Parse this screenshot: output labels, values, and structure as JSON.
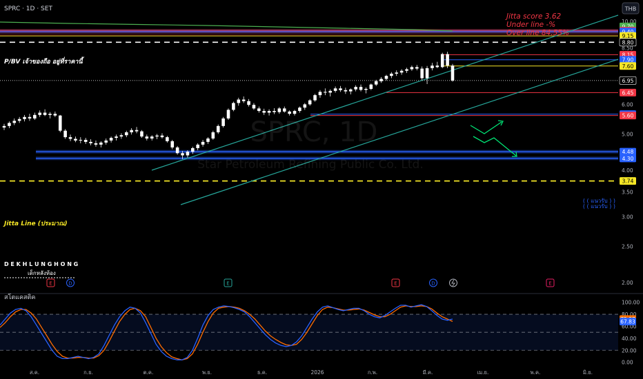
{
  "header": {
    "symbol_line": "SPRC · 1D · SET",
    "currency": "THB"
  },
  "watermark": {
    "ticker": "SPRC, 1D",
    "company": "Star Petroleum Refining Public Co. Ltd."
  },
  "jitta": {
    "score_text": "Jitta score  3.62",
    "under_text": "Under line  -%",
    "over_text": "Over line  84.55%"
  },
  "annotations": {
    "pbv_label": "P/BV เจ้าของถือ อยู่ที่ราคานี้",
    "jitta_line_label": "Jitta Line (ประมาณ)",
    "brand_name": "D E K H L U N G H O N G",
    "brand_sub": "เด็กหลังห้อง",
    "support_upper": "( ( แนวรับ ) )",
    "support_lower": "( ( แนวรับ ) )"
  },
  "colors": {
    "background": "#000000",
    "up_candle": "#ffffff",
    "down_candle": "#ffffff",
    "channel": "#26a69a",
    "ma_line": "#4caf50",
    "red_level": "#f23645",
    "blue_level": "#2962ff",
    "yellow_level": "#f5e626",
    "stoch_k": "#2962ff",
    "stoch_d": "#ff6d00",
    "arrow": "#00e676",
    "jitta_text": "#f23645",
    "event_earnings": "#f23645",
    "event_dividend": "#2962ff",
    "event_split": "#26a69a"
  },
  "chart_data": [
    {
      "type": "candlestick",
      "title": "SPRC · 1D · SET",
      "y_axis": {
        "scale": "log",
        "range": [
          1.9,
          10.4
        ],
        "ticks": [
          "10.00",
          "9.50",
          "9.00",
          "8.50",
          "8.00",
          "7.50",
          "7.00",
          "6.50",
          "6.00",
          "5.50",
          "5.00",
          "4.50",
          "4.00",
          "3.50",
          "3.00",
          "2.50",
          "2.00"
        ]
      },
      "x_axis": {
        "labels": [
          "ส.ค.",
          "ก.ย.",
          "ต.ค.",
          "พ.ย.",
          "ธ.ค.",
          "2026",
          "ก.พ.",
          "มี.ค.",
          "เม.ย.",
          "พ.ค.",
          "มิ.ย."
        ]
      },
      "price_levels": [
        {
          "value": 9.7,
          "label": "9.70",
          "color": "#4caf50",
          "style": "line"
        },
        {
          "value": 9.45,
          "label": "9.45",
          "color": "#f23645",
          "style": "zone"
        },
        {
          "value": 9.4,
          "label": "9.40",
          "color": "#2962ff",
          "style": "zone"
        },
        {
          "value": 9.15,
          "label": "9.15",
          "color": "#f5e626",
          "style": "solid"
        },
        {
          "value": 8.8,
          "label": "8.80",
          "color": "#ffffff",
          "style": "dashed"
        },
        {
          "value": 8.15,
          "label": "8.15",
          "color": "#f23645",
          "style": "solid"
        },
        {
          "value": 7.9,
          "label": "7.90",
          "color": "#2962ff",
          "style": "solid"
        },
        {
          "value": 7.6,
          "label": "7.60",
          "color": "#f5e626",
          "style": "solid"
        },
        {
          "value": 6.95,
          "label": "6.95",
          "color": "#ffffff",
          "style": "dotted"
        },
        {
          "value": 6.45,
          "label": "6.45",
          "color": "#f23645",
          "style": "solid"
        },
        {
          "value": 5.65,
          "label": "5.65",
          "color": "#2962ff",
          "style": "solid"
        },
        {
          "value": 5.6,
          "label": "5.60",
          "color": "#f23645",
          "style": "solid"
        },
        {
          "value": 4.48,
          "label": "4.48",
          "color": "#2962ff",
          "style": "zone"
        },
        {
          "value": 4.3,
          "label": "4.30",
          "color": "#2962ff",
          "style": "zone"
        },
        {
          "value": 3.74,
          "label": "3.74",
          "color": "#f5e626",
          "style": "dashed"
        }
      ],
      "candles": [
        [
          5.2,
          5.32,
          5.12,
          5.25
        ],
        [
          5.25,
          5.4,
          5.18,
          5.35
        ],
        [
          5.35,
          5.5,
          5.28,
          5.42
        ],
        [
          5.42,
          5.55,
          5.35,
          5.48
        ],
        [
          5.48,
          5.62,
          5.4,
          5.55
        ],
        [
          5.55,
          5.66,
          5.42,
          5.5
        ],
        [
          5.5,
          5.7,
          5.45,
          5.62
        ],
        [
          5.62,
          5.78,
          5.55,
          5.7
        ],
        [
          5.7,
          5.82,
          5.58,
          5.62
        ],
        [
          5.62,
          5.72,
          5.5,
          5.66
        ],
        [
          5.66,
          5.74,
          5.55,
          5.6
        ],
        [
          5.6,
          5.62,
          5.05,
          5.1
        ],
        [
          5.1,
          5.15,
          4.85,
          4.9
        ],
        [
          4.9,
          4.98,
          4.78,
          4.85
        ],
        [
          4.85,
          4.92,
          4.75,
          4.8
        ],
        [
          4.8,
          4.9,
          4.72,
          4.82
        ],
        [
          4.82,
          4.88,
          4.7,
          4.76
        ],
        [
          4.76,
          4.84,
          4.66,
          4.72
        ],
        [
          4.72,
          4.8,
          4.62,
          4.68
        ],
        [
          4.68,
          4.78,
          4.6,
          4.74
        ],
        [
          4.74,
          4.86,
          4.68,
          4.8
        ],
        [
          4.8,
          4.92,
          4.74,
          4.88
        ],
        [
          4.88,
          4.98,
          4.8,
          4.92
        ],
        [
          4.92,
          5.02,
          4.85,
          4.96
        ],
        [
          4.96,
          5.1,
          4.9,
          5.05
        ],
        [
          5.05,
          5.18,
          4.98,
          5.12
        ],
        [
          5.12,
          5.22,
          5.02,
          5.08
        ],
        [
          5.08,
          5.12,
          4.88,
          4.92
        ],
        [
          4.92,
          4.98,
          4.8,
          4.86
        ],
        [
          4.86,
          4.96,
          4.8,
          4.92
        ],
        [
          4.92,
          5.0,
          4.84,
          4.95
        ],
        [
          4.95,
          5.02,
          4.86,
          4.9
        ],
        [
          4.9,
          4.94,
          4.74,
          4.78
        ],
        [
          4.78,
          4.82,
          4.55,
          4.6
        ],
        [
          4.6,
          4.64,
          4.4,
          4.44
        ],
        [
          4.44,
          4.5,
          4.28,
          4.38
        ],
        [
          4.38,
          4.52,
          4.32,
          4.48
        ],
        [
          4.48,
          4.62,
          4.42,
          4.58
        ],
        [
          4.58,
          4.72,
          4.52,
          4.68
        ],
        [
          4.68,
          4.82,
          4.62,
          4.76
        ],
        [
          4.76,
          4.9,
          4.7,
          4.86
        ],
        [
          4.86,
          5.1,
          4.82,
          5.05
        ],
        [
          5.05,
          5.3,
          5.0,
          5.25
        ],
        [
          5.25,
          5.55,
          5.2,
          5.5
        ],
        [
          5.5,
          5.85,
          5.45,
          5.8
        ],
        [
          5.8,
          6.1,
          5.75,
          6.05
        ],
        [
          6.05,
          6.25,
          5.95,
          6.18
        ],
        [
          6.18,
          6.3,
          6.05,
          6.12
        ],
        [
          6.12,
          6.2,
          5.92,
          5.98
        ],
        [
          5.98,
          6.05,
          5.8,
          5.85
        ],
        [
          5.85,
          5.92,
          5.7,
          5.76
        ],
        [
          5.76,
          5.84,
          5.62,
          5.7
        ],
        [
          5.7,
          5.82,
          5.6,
          5.76
        ],
        [
          5.76,
          5.86,
          5.65,
          5.72
        ],
        [
          5.72,
          5.9,
          5.66,
          5.85
        ],
        [
          5.85,
          5.92,
          5.7,
          5.74
        ],
        [
          5.74,
          5.78,
          5.6,
          5.66
        ],
        [
          5.66,
          5.8,
          5.6,
          5.76
        ],
        [
          5.76,
          5.92,
          5.7,
          5.88
        ],
        [
          5.88,
          6.05,
          5.8,
          6.0
        ],
        [
          6.0,
          6.2,
          5.95,
          6.15
        ],
        [
          6.15,
          6.4,
          6.1,
          6.35
        ],
        [
          6.35,
          6.55,
          6.25,
          6.48
        ],
        [
          6.48,
          6.62,
          6.35,
          6.45
        ],
        [
          6.45,
          6.58,
          6.3,
          6.52
        ],
        [
          6.52,
          6.7,
          6.45,
          6.62
        ],
        [
          6.62,
          6.72,
          6.48,
          6.55
        ],
        [
          6.55,
          6.65,
          6.4,
          6.5
        ],
        [
          6.5,
          6.62,
          6.38,
          6.58
        ],
        [
          6.58,
          6.75,
          6.5,
          6.68
        ],
        [
          6.68,
          6.78,
          6.5,
          6.56
        ],
        [
          6.56,
          6.66,
          6.42,
          6.6
        ],
        [
          6.6,
          6.82,
          6.55,
          6.78
        ],
        [
          6.78,
          6.98,
          6.72,
          6.92
        ],
        [
          6.92,
          7.1,
          6.85,
          7.02
        ],
        [
          7.02,
          7.2,
          6.95,
          7.15
        ],
        [
          7.15,
          7.32,
          7.05,
          7.25
        ],
        [
          7.25,
          7.4,
          7.15,
          7.3
        ],
        [
          7.3,
          7.45,
          7.2,
          7.38
        ],
        [
          7.38,
          7.52,
          7.28,
          7.45
        ],
        [
          7.45,
          7.62,
          7.38,
          7.55
        ],
        [
          7.55,
          7.65,
          7.4,
          7.48
        ],
        [
          7.48,
          7.58,
          6.95,
          7.05
        ],
        [
          7.05,
          7.6,
          6.8,
          7.5
        ],
        [
          7.5,
          7.75,
          7.4,
          7.62
        ],
        [
          7.62,
          7.8,
          7.5,
          7.55
        ],
        [
          7.55,
          8.25,
          7.5,
          8.18
        ],
        [
          8.18,
          8.3,
          7.5,
          7.62
        ],
        [
          7.62,
          7.7,
          6.9,
          6.95
        ]
      ]
    },
    {
      "type": "line",
      "title": "สโตแคสติค",
      "y_axis": {
        "range": [
          -5,
          110
        ],
        "ticks": [
          "100.00",
          "80.00",
          "60.00",
          "40.00",
          "20.00",
          "0.00"
        ]
      },
      "reference_lines": [
        80,
        50,
        20
      ],
      "last_values": {
        "k": "72.07",
        "d": "67.83"
      },
      "series": [
        {
          "values": [
            62,
            72,
            82,
            88,
            90,
            86,
            76,
            62,
            48,
            34,
            20,
            10,
            6,
            6,
            8,
            10,
            8,
            6,
            8,
            14,
            28,
            45,
            62,
            76,
            86,
            92,
            90,
            82,
            66,
            48,
            30,
            18,
            10,
            6,
            4,
            4,
            8,
            20,
            40,
            62,
            78,
            88,
            92,
            94,
            93,
            91,
            88,
            84,
            76,
            66,
            56,
            46,
            38,
            32,
            28,
            26,
            28,
            34,
            44,
            58,
            72,
            84,
            92,
            94,
            91,
            88,
            86,
            88,
            90,
            90,
            86,
            80,
            76,
            74,
            78,
            84,
            90,
            95,
            95,
            92,
            94,
            96,
            93,
            86,
            78,
            72,
            70,
            72
          ]
        },
        {
          "values": [
            58,
            66,
            76,
            84,
            88,
            88,
            82,
            72,
            58,
            44,
            30,
            18,
            10,
            7,
            7,
            8,
            8,
            7,
            7,
            11,
            20,
            35,
            52,
            68,
            80,
            88,
            90,
            86,
            76,
            58,
            40,
            26,
            16,
            9,
            6,
            4,
            6,
            14,
            30,
            50,
            68,
            82,
            90,
            92,
            93,
            92,
            90,
            86,
            80,
            72,
            62,
            52,
            44,
            38,
            33,
            29,
            28,
            30,
            38,
            50,
            64,
            78,
            88,
            92,
            91,
            89,
            87,
            87,
            88,
            89,
            87,
            83,
            79,
            76,
            76,
            80,
            86,
            92,
            94,
            93,
            93,
            94,
            93,
            89,
            82,
            76,
            72,
            68
          ]
        }
      ]
    }
  ]
}
